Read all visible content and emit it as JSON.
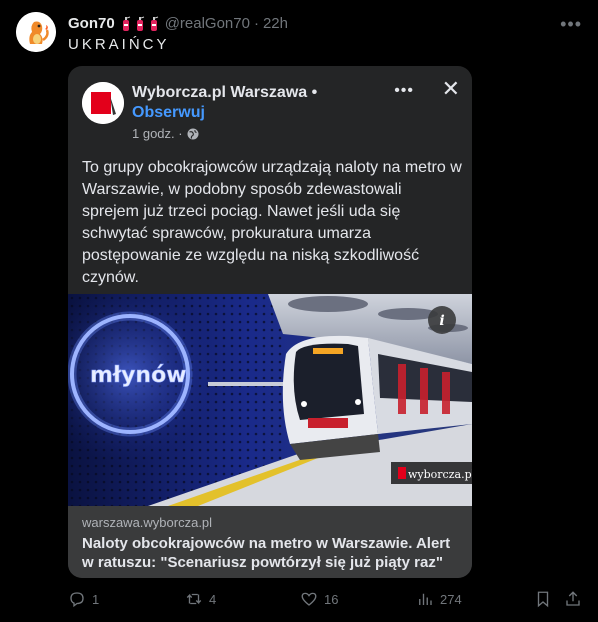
{
  "tweet": {
    "author_name": "Gon70",
    "handle": "@realGon70",
    "separator": "·",
    "time": "22h",
    "text": "UKRAIŃCY",
    "more_icon": "more-horizontal-icon"
  },
  "quoted_post": {
    "page_name": "Wyborcza.pl Warszawa",
    "separator": "•",
    "follow_label": "Obserwuj",
    "time": "1 godz. ·",
    "privacy_icon": "globe-icon",
    "body": "To grupy obcokrajowców urządzają naloty na metro w Warszawie, w podobny sposób zdewastowali sprejem już trzeci pociąg. Nawet jeśli uda się schwytać sprawców, prokuratura umarza postępowanie ze względu na niską szkodliwość czynów.",
    "photo": {
      "station_sign": "młynów",
      "watermark": "wyborcza.pl",
      "info_icon": "info-icon"
    },
    "link": {
      "domain": "warszawa.wyborcza.pl",
      "title": "Naloty obcokrajowców na metro w Warszawie. Alert w ratuszu: \"Scenariusz powtórzył się już piąty raz\""
    }
  },
  "actions": {
    "replies": "1",
    "retweets": "4",
    "likes": "16",
    "views": "274"
  },
  "colors": {
    "background": "#000000",
    "card": "#242526",
    "link_footer": "#3a3b3c",
    "follow": "#4599ff",
    "muted": "#71767b"
  }
}
